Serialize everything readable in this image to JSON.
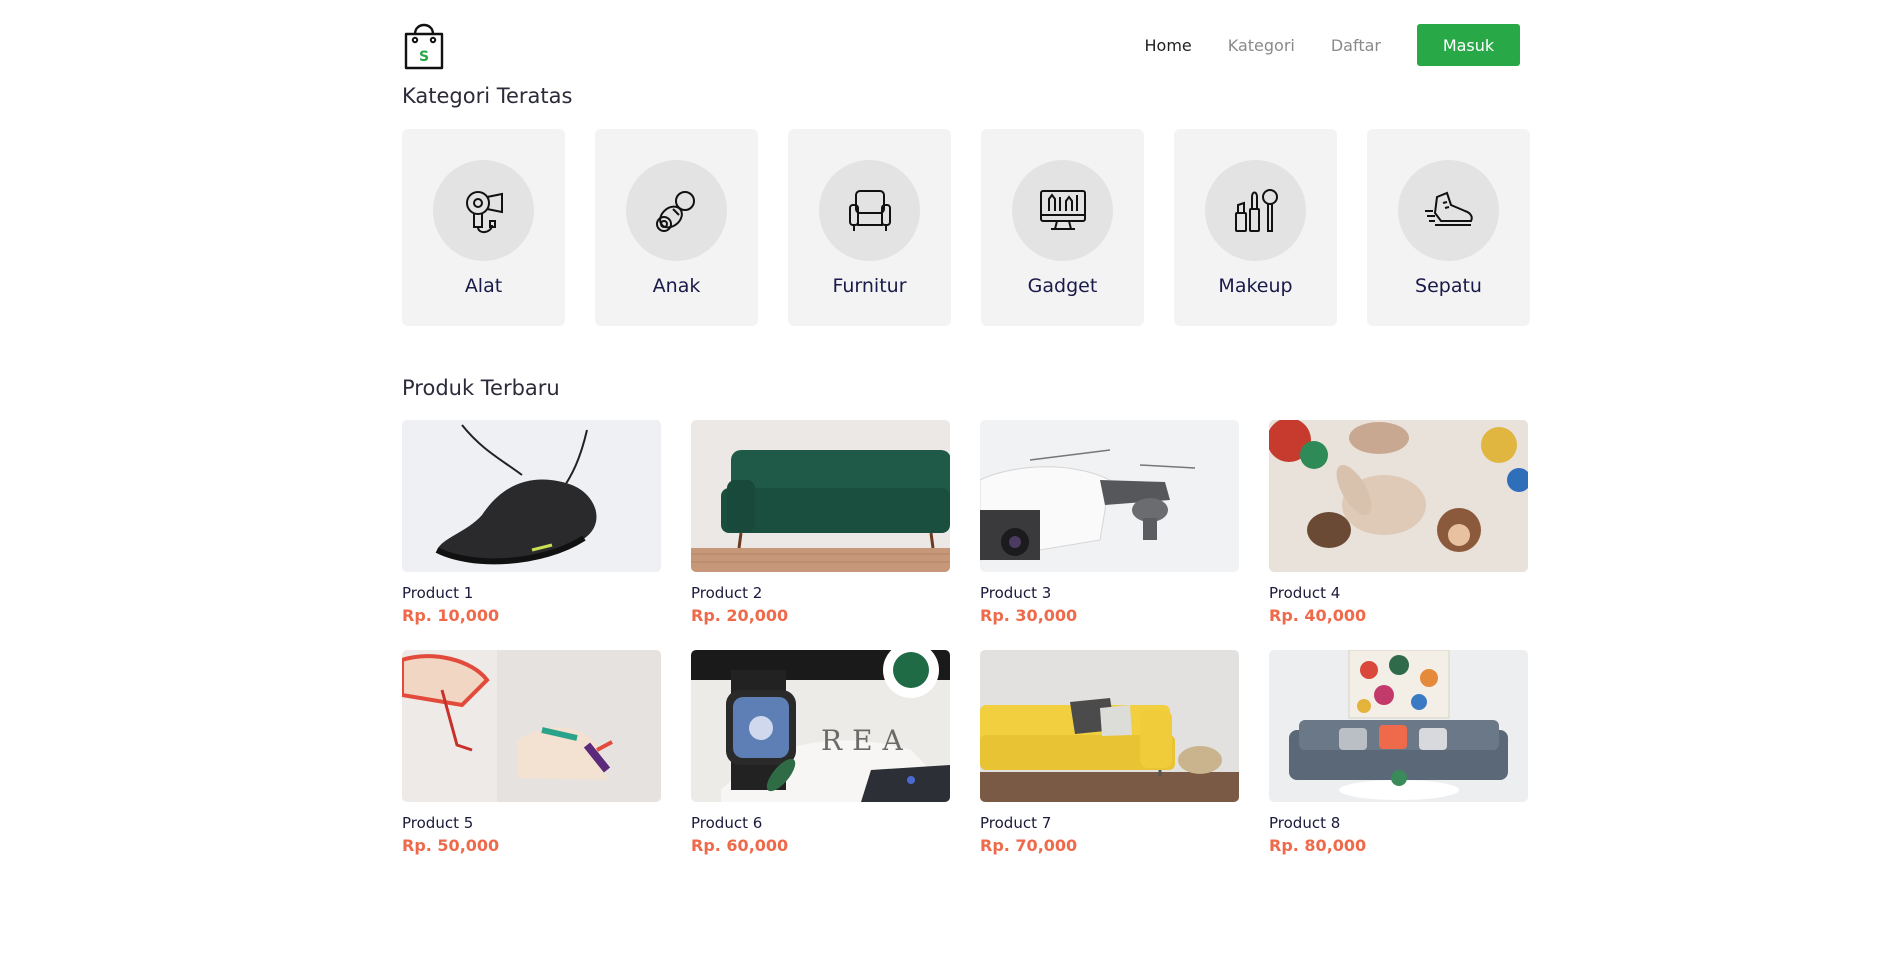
{
  "nav": {
    "logo_letter": "S",
    "items": [
      {
        "label": "Home",
        "active": true
      },
      {
        "label": "Kategori",
        "active": false
      },
      {
        "label": "Daftar",
        "active": false
      }
    ],
    "login_button": "Masuk",
    "accent_color": "#29a847"
  },
  "categories_section": {
    "title": "Kategori Teratas",
    "items": [
      {
        "label": "Alat",
        "icon": "hair-dryer-icon"
      },
      {
        "label": "Anak",
        "icon": "pacifier-icon"
      },
      {
        "label": "Furnitur",
        "icon": "armchair-icon"
      },
      {
        "label": "Gadget",
        "icon": "monitor-tools-icon"
      },
      {
        "label": "Makeup",
        "icon": "makeup-icon"
      },
      {
        "label": "Sepatu",
        "icon": "sneaker-icon"
      }
    ]
  },
  "products_section": {
    "title": "Produk Terbaru",
    "price_color": "#ef6a4b",
    "items": [
      {
        "name": "Product 1",
        "price": "Rp. 10,000",
        "image": "black-sneaker-photo"
      },
      {
        "name": "Product 2",
        "price": "Rp. 20,000",
        "image": "green-sofa-photo"
      },
      {
        "name": "Product 3",
        "price": "Rp. 30,000",
        "image": "drone-photo"
      },
      {
        "name": "Product 4",
        "price": "Rp. 40,000",
        "image": "plush-toys-photo"
      },
      {
        "name": "Product 5",
        "price": "Rp. 50,000",
        "image": "colorful-sneakers-photo"
      },
      {
        "name": "Product 6",
        "price": "Rp. 60,000",
        "image": "smartwatch-photo"
      },
      {
        "name": "Product 7",
        "price": "Rp. 70,000",
        "image": "yellow-sofa-photo"
      },
      {
        "name": "Product 8",
        "price": "Rp. 80,000",
        "image": "grey-sofa-living-room-photo"
      }
    ]
  }
}
